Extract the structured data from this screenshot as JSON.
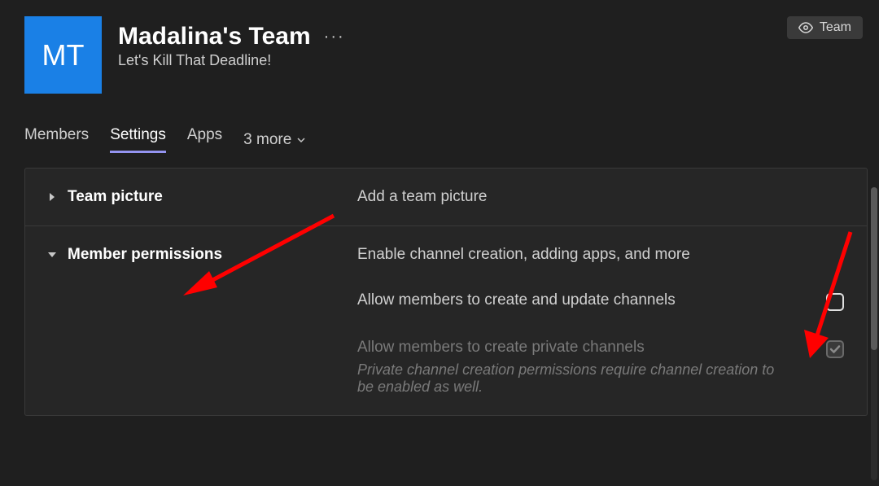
{
  "header": {
    "avatar_initials": "MT",
    "team_name": "Madalina's Team",
    "tagline": "Let's Kill That Deadline!",
    "visibility_label": "Team"
  },
  "tabs": {
    "items": [
      "Members",
      "Settings",
      "Apps"
    ],
    "more_label": "3 more",
    "active_index": 1
  },
  "sections": {
    "team_picture": {
      "title": "Team picture",
      "description": "Add a team picture",
      "expanded": false
    },
    "member_permissions": {
      "title": "Member permissions",
      "description": "Enable channel creation, adding apps, and more",
      "expanded": true,
      "options": {
        "create_update_channels": {
          "label": "Allow members to create and update channels",
          "checked": false,
          "disabled": false
        },
        "create_private_channels": {
          "label": "Allow members to create private channels",
          "help": "Private channel creation permissions require channel creation to be enabled as well.",
          "checked": true,
          "disabled": true
        }
      }
    }
  }
}
